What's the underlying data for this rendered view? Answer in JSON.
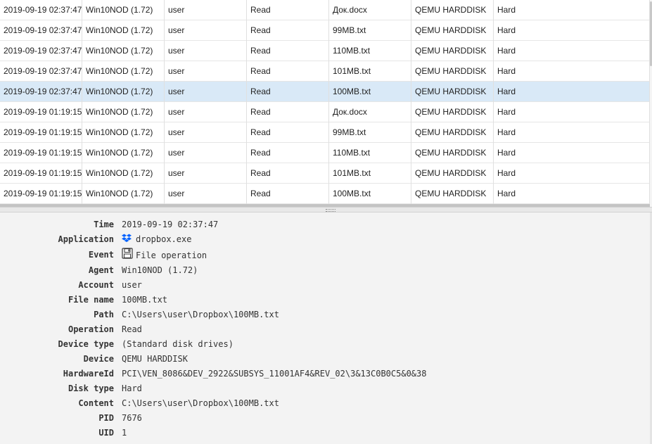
{
  "table": {
    "rows": [
      {
        "time": "2019-09-19 02:37:47",
        "agent": "Win10NOD (1.72)",
        "account": "user",
        "operation": "Read",
        "file": "Док.docx",
        "device": "QEMU HARDDISK",
        "disk_type": "Hard"
      },
      {
        "time": "2019-09-19 02:37:47",
        "agent": "Win10NOD (1.72)",
        "account": "user",
        "operation": "Read",
        "file": "99MB.txt",
        "device": "QEMU HARDDISK",
        "disk_type": "Hard"
      },
      {
        "time": "2019-09-19 02:37:47",
        "agent": "Win10NOD (1.72)",
        "account": "user",
        "operation": "Read",
        "file": "110MB.txt",
        "device": "QEMU HARDDISK",
        "disk_type": "Hard"
      },
      {
        "time": "2019-09-19 02:37:47",
        "agent": "Win10NOD (1.72)",
        "account": "user",
        "operation": "Read",
        "file": "101MB.txt",
        "device": "QEMU HARDDISK",
        "disk_type": "Hard"
      },
      {
        "time": "2019-09-19 02:37:47",
        "agent": "Win10NOD (1.72)",
        "account": "user",
        "operation": "Read",
        "file": "100MB.txt",
        "device": "QEMU HARDDISK",
        "disk_type": "Hard",
        "selected": true
      },
      {
        "time": "2019-09-19 01:19:15",
        "agent": "Win10NOD (1.72)",
        "account": "user",
        "operation": "Read",
        "file": "Док.docx",
        "device": "QEMU HARDDISK",
        "disk_type": "Hard"
      },
      {
        "time": "2019-09-19 01:19:15",
        "agent": "Win10NOD (1.72)",
        "account": "user",
        "operation": "Read",
        "file": "99MB.txt",
        "device": "QEMU HARDDISK",
        "disk_type": "Hard"
      },
      {
        "time": "2019-09-19 01:19:15",
        "agent": "Win10NOD (1.72)",
        "account": "user",
        "operation": "Read",
        "file": "110MB.txt",
        "device": "QEMU HARDDISK",
        "disk_type": "Hard"
      },
      {
        "time": "2019-09-19 01:19:15",
        "agent": "Win10NOD (1.72)",
        "account": "user",
        "operation": "Read",
        "file": "101MB.txt",
        "device": "QEMU HARDDISK",
        "disk_type": "Hard"
      },
      {
        "time": "2019-09-19 01:19:15",
        "agent": "Win10NOD (1.72)",
        "account": "user",
        "operation": "Read",
        "file": "100MB.txt",
        "device": "QEMU HARDDISK",
        "disk_type": "Hard"
      }
    ]
  },
  "details": {
    "time": {
      "label": "Time",
      "value": "2019-09-19 02:37:47"
    },
    "application": {
      "label": "Application",
      "value": "dropbox.exe",
      "icon": "dropbox-icon"
    },
    "event": {
      "label": "Event",
      "value": "File operation",
      "icon": "floppy-disk-icon"
    },
    "agent": {
      "label": "Agent",
      "value": "Win10NOD (1.72)"
    },
    "account": {
      "label": "Account",
      "value": "user"
    },
    "file_name": {
      "label": "File name",
      "value": "100MB.txt"
    },
    "path": {
      "label": "Path",
      "value": "C:\\Users\\user\\Dropbox\\100MB.txt"
    },
    "operation": {
      "label": "Operation",
      "value": "Read"
    },
    "device_type": {
      "label": "Device type",
      "value": "(Standard disk drives)"
    },
    "device": {
      "label": "Device",
      "value": "QEMU HARDDISK"
    },
    "hardware_id": {
      "label": "HardwareId",
      "value": "PCI\\VEN_8086&DEV_2922&SUBSYS_11001AF4&REV_02\\3&13C0B0C5&0&38"
    },
    "disk_type": {
      "label": "Disk type",
      "value": "Hard"
    },
    "content": {
      "label": "Content",
      "value": "C:\\Users\\user\\Dropbox\\100MB.txt"
    },
    "pid": {
      "label": "PID",
      "value": "7676"
    },
    "uid": {
      "label": "UID",
      "value": "1"
    }
  },
  "colors": {
    "selected_row": "#d9e9f7",
    "dropbox_blue": "#0061fe"
  }
}
